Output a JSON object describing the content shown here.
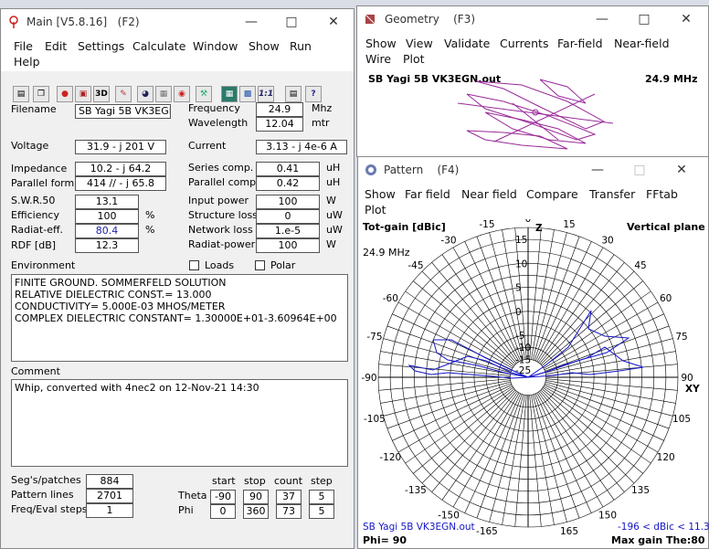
{
  "main": {
    "title": "Main [V5.8.16]",
    "hotkey": "(F2)",
    "menu": [
      "File",
      "Edit",
      "Settings",
      "Calculate",
      "Window",
      "Show",
      "Run",
      "Help"
    ],
    "toolbar_icons": [
      "open-icon",
      "copy-icon",
      "bulb-icon",
      "cube-icon",
      "3d-icon",
      "edit-icon",
      "globe-icon",
      "grid-icon",
      "target-icon",
      "tools-icon",
      "calc-icon",
      "chart-icon",
      "ratio-icon",
      "book-icon",
      "help-icon"
    ],
    "toolbar_labels": {
      "threed": "3D",
      "ratio": "1:1",
      "help": "?"
    },
    "fields": {
      "filename_label": "Filename",
      "filename": "SB Yagi 5B VK3EGN",
      "frequency_label": "Frequency",
      "frequency": "24.9",
      "frequency_unit": "Mhz",
      "wavelength_label": "Wavelength",
      "wavelength": "12.04",
      "wavelength_unit": "mtr",
      "voltage_label": "Voltage",
      "voltage": "31.9 - j 201 V",
      "current_label": "Current",
      "current": "3.13 - j 4e-6 A",
      "impedance_label": "Impedance",
      "impedance": "10.2 - j 64.2",
      "parallel_label": "Parallel form",
      "parallel": "414 // - j 65.8",
      "swr_label": "S.W.R.50",
      "swr": "13.1",
      "efficiency_label": "Efficiency",
      "efficiency": "100",
      "efficiency_unit": "%",
      "radeff_label": "Radiat-eff.",
      "radeff": "80.4",
      "radeff_unit": "%",
      "rdf_label": "RDF [dB]",
      "rdf": "12.3",
      "series_comp_label": "Series comp.",
      "series_comp": "0.41",
      "series_comp_unit": "uH",
      "parallel_comp_label": "Parallel comp.",
      "parallel_comp": "0.42",
      "parallel_comp_unit": "uH",
      "input_power_label": "Input power",
      "input_power": "100",
      "input_power_unit": "W",
      "structure_loss_label": "Structure loss",
      "structure_loss": "0",
      "structure_loss_unit": "uW",
      "network_loss_label": "Network loss",
      "network_loss": "1.e-5",
      "network_loss_unit": "uW",
      "radiat_power_label": "Radiat-power",
      "radiat_power": "100",
      "radiat_power_unit": "W"
    },
    "environment_label": "Environment",
    "loads_label": "Loads",
    "polar_label": "Polar",
    "environment_lines": [
      "FINITE GROUND.  SOMMERFELD SOLUTION",
      "RELATIVE DIELECTRIC CONST.= 13.000",
      "CONDUCTIVITY= 5.000E-03 MHOS/METER",
      "COMPLEX DIELECTRIC CONSTANT= 1.30000E+01-3.60964E+00"
    ],
    "comment_label": "Comment",
    "comment": "Whip, converted with 4nec2 on 12-Nov-21 14:30",
    "segs_label": "Seg's/patches",
    "segs": "884",
    "pattern_lines_label": "Pattern lines",
    "pattern_lines": "2701",
    "freq_eval_label": "Freq/Eval steps",
    "freq_eval": "1",
    "col_headers": [
      "start",
      "stop",
      "count",
      "step"
    ],
    "theta_label": "Theta",
    "theta": [
      "-90",
      "90",
      "37",
      "5"
    ],
    "phi_label": "Phi",
    "phi": [
      "0",
      "360",
      "73",
      "5"
    ]
  },
  "geometry": {
    "title": "Geometry",
    "hotkey": "(F3)",
    "menu": [
      "Show",
      "View",
      "Validate",
      "Currents",
      "Far-field",
      "Near-field",
      "Wire",
      "Plot"
    ],
    "filename": "SB Yagi 5B VK3EGN.out",
    "freq": "24.9 MHz"
  },
  "pattern": {
    "title": "Pattern",
    "hotkey": "(F4)",
    "menu": [
      "Show",
      "Far field",
      "Near field",
      "Compare",
      "Transfer",
      "FFtab",
      "Plot"
    ],
    "gain_label": "Tot-gain [dBic]",
    "plane": "Vertical plane",
    "freq": "24.9 MHz",
    "z_label": "Z",
    "xy_label": "XY",
    "angle_labels": {
      "0": "0",
      "15": "15",
      "30": "30",
      "45": "45",
      "60": "60",
      "75": "75",
      "90": "90",
      "105": "105",
      "120": "120",
      "135": "135",
      "150": "150",
      "165": "165",
      "m15": "-15",
      "m30": "-30",
      "m45": "-45",
      "m60": "-60",
      "m75": "-75",
      "m90": "-90",
      "m105": "-105",
      "m120": "-120",
      "m135": "-135",
      "m150": "-150",
      "m165": "-165"
    },
    "radial_labels": [
      "15",
      "10",
      "5",
      "0",
      "-5",
      "-10",
      "-15",
      "-25"
    ],
    "footer_file": "SB Yagi 5B VK3EGN.out",
    "footer_range": "-196 < dBic < 11.3",
    "phi": "Phi= 90",
    "max_gain": "Max gain The:80",
    "colors": {
      "trace": "#1515c8",
      "grid": "#000000"
    }
  }
}
